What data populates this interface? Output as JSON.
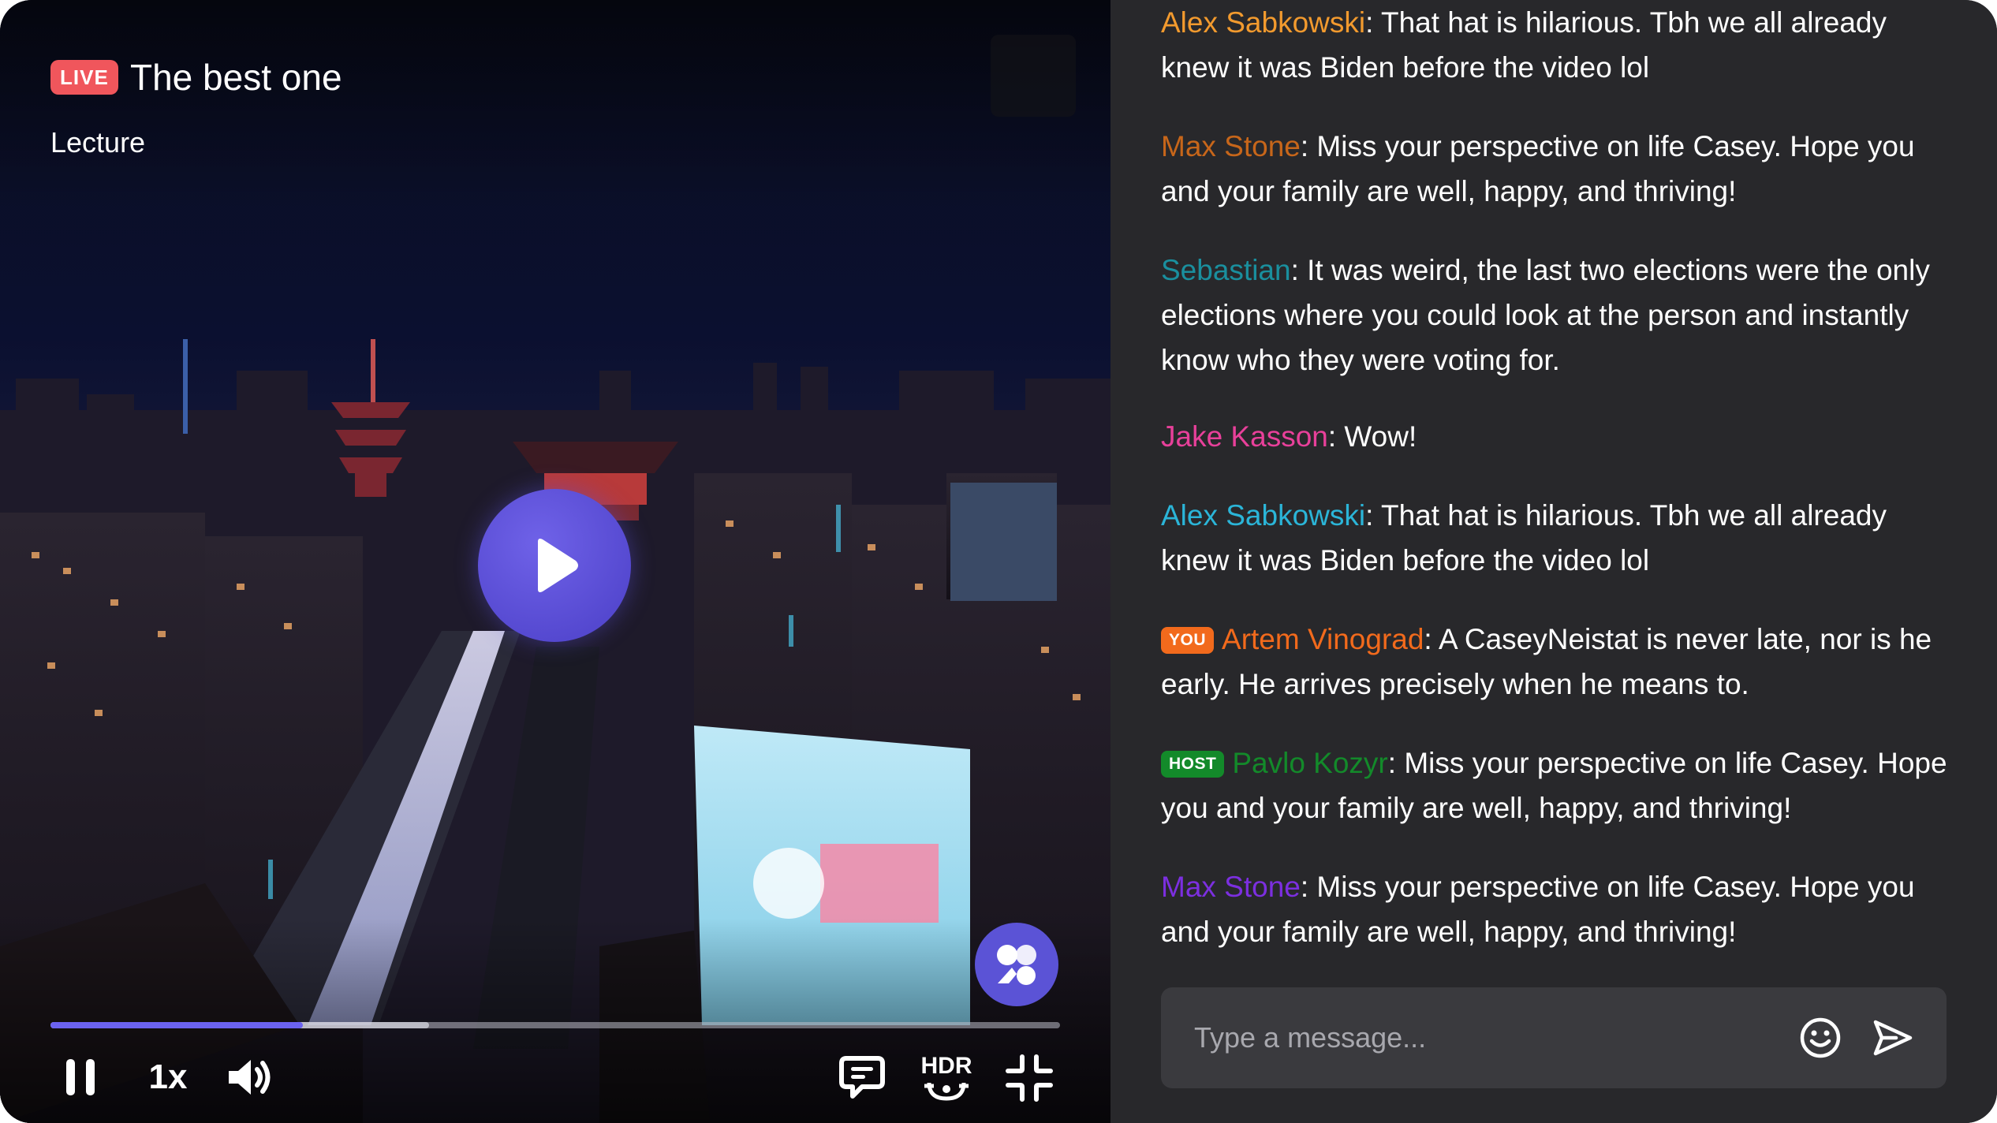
{
  "video": {
    "live_badge": "LIVE",
    "title": "The best one",
    "category": "Lecture",
    "progress": 0.25,
    "buffered": 0.375,
    "speed_label": "1x",
    "hdr_label": "HDR",
    "accent_color": "#6b62f0",
    "live_color": "#f0565c"
  },
  "controls": {
    "icons": [
      "pause-icon",
      "speed-label",
      "volume-icon",
      "chat-toggle-icon",
      "hdr-icon",
      "exit-fullscreen-icon"
    ]
  },
  "chat": {
    "messages": [
      {
        "author": "Alex Sabkowski",
        "color": "#f29a2e",
        "text": ": That hat is hilarious. Tbh we all already knew it was Biden before the video lol",
        "tag": null
      },
      {
        "author": "Max Stone",
        "color": "#c7661a",
        "text": ": Miss your perspective on life Casey.  Hope you and your family are well, happy, and thriving!",
        "tag": null
      },
      {
        "author": "Sebastian",
        "color": "#1a8f9e",
        "text": ": It was weird, the last two elections were the only elections where you could look at the person and instantly know who they were voting for.",
        "tag": null
      },
      {
        "author": "Jake Kasson",
        "color": "#e8409a",
        "text": ": Wow!",
        "tag": null
      },
      {
        "author": "Alex Sabkowski",
        "color": "#2bb5d8",
        "text": ": That hat is hilarious. Tbh we all already knew it was Biden before the video lol",
        "tag": null
      },
      {
        "author": "Artem Vinograd",
        "color": "#f26a1c",
        "text": ": A CaseyNeistat is never late, nor is he early. He arrives precisely when he means to.",
        "tag": "YOU",
        "tag_color": "#f26a1c"
      },
      {
        "author": "Pavlo Kozyr",
        "color": "#138a2a",
        "text": ": Miss your perspective on life Casey. Hope you and your family are well, happy, and thriving!",
        "tag": "HOST",
        "tag_color": "#138a2a"
      },
      {
        "author": "Max Stone",
        "color": "#7c2fe0",
        "text": ": Miss your perspective on life Casey.  Hope you and your family are well, happy, and thriving!",
        "tag": null
      }
    ],
    "input_placeholder": "Type a message...",
    "input_value": "",
    "input_icons": [
      "emoji-icon",
      "send-icon"
    ]
  }
}
